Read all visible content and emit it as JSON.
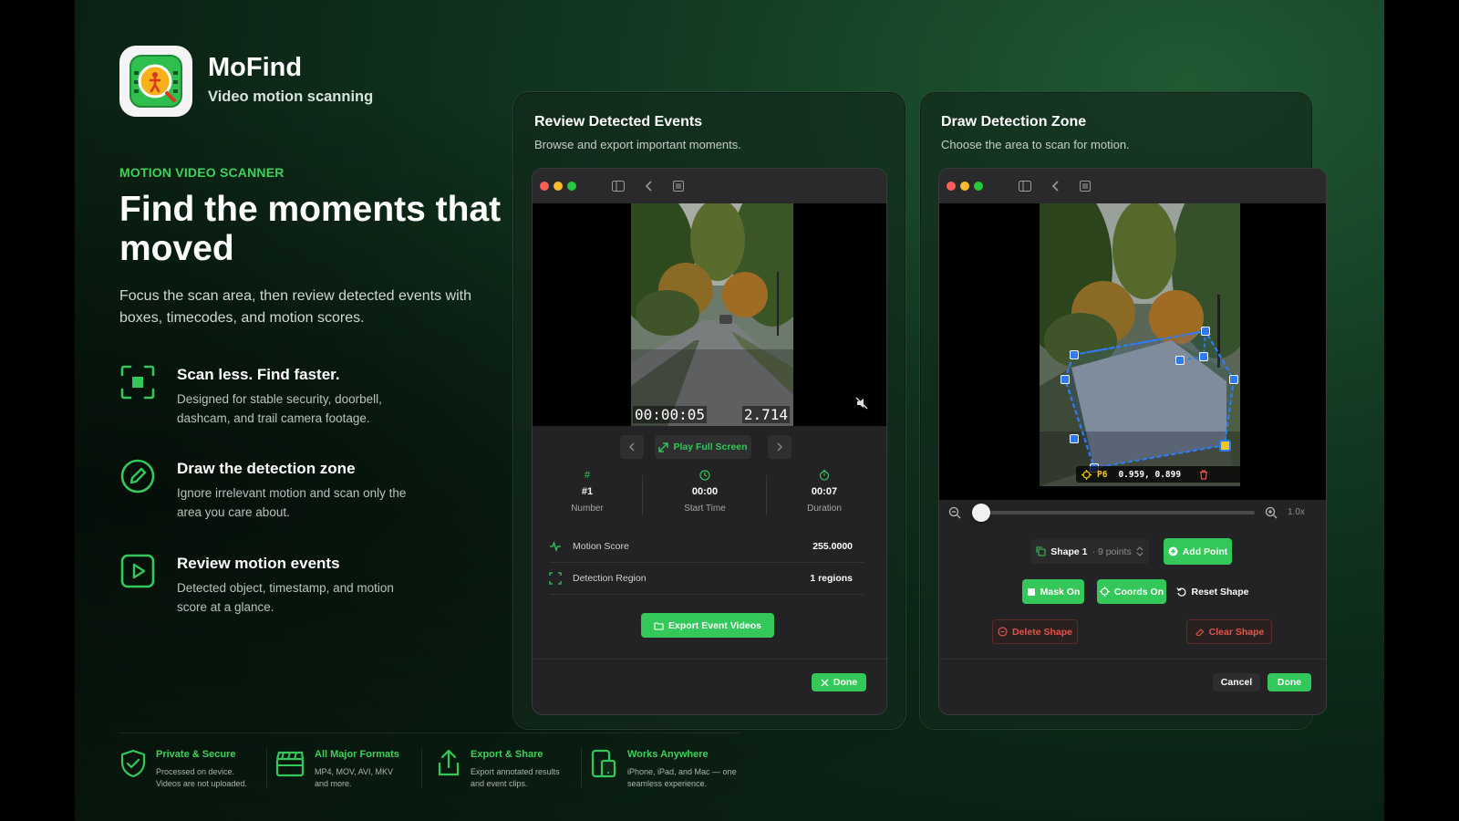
{
  "app": {
    "name": "MoFind",
    "subtitle": "Video motion scanning"
  },
  "hero": {
    "eyebrow": "MOTION VIDEO SCANNER",
    "headline": "Find the moments that moved",
    "lede": "Focus the scan area, then review detected events with boxes, timecodes, and motion scores."
  },
  "features": [
    {
      "title": "Scan less. Find faster.",
      "desc": "Designed for stable security, doorbell, dashcam, and trail camera footage.",
      "icon": "scan-frame-icon"
    },
    {
      "title": "Draw the detection zone",
      "desc": "Ignore irrelevant motion and scan only the area you care about.",
      "icon": "pencil-circle-icon"
    },
    {
      "title": "Review motion events",
      "desc": "Detected object, timestamp, and motion score at a glance.",
      "icon": "play-square-icon"
    }
  ],
  "strip": [
    {
      "title": "Private & Secure",
      "desc": "Processed on device. Videos are not uploaded.",
      "icon": "shield-check-icon"
    },
    {
      "title": "All Major Formats",
      "desc": "MP4, MOV, AVI, MKV and more.",
      "icon": "clapperboard-icon"
    },
    {
      "title": "Export & Share",
      "desc": "Export annotated results and event clips.",
      "icon": "share-icon"
    },
    {
      "title": "Works Anywhere",
      "desc": "iPhone, iPad, and Mac — one seamless experience.",
      "icon": "devices-icon"
    }
  ],
  "review": {
    "title": "Review Detected Events",
    "subtitle": "Browse and export important moments.",
    "timecode": "00:00:05",
    "score_overlay": "2.714",
    "play_full_screen": "Play Full Screen",
    "stats": [
      {
        "icon": "#",
        "value": "#1",
        "label": "Number"
      },
      {
        "icon": "clock-icon",
        "value": "00:00",
        "label": "Start Time"
      },
      {
        "icon": "timer-icon",
        "value": "00:07",
        "label": "Duration"
      }
    ],
    "rows": [
      {
        "label": "Motion Score",
        "value": "255.0000",
        "icon": "waveform-icon"
      },
      {
        "label": "Detection Region",
        "value": "1 regions",
        "icon": "region-icon"
      }
    ],
    "export_label": "Export Event Videos",
    "done_label": "Done"
  },
  "zone": {
    "title": "Draw Detection Zone",
    "subtitle": "Choose the area to scan for motion.",
    "point_label": "P6",
    "point_coords": "0.959, 0.899",
    "zoom_label": "1.0x",
    "zoom_level": 0.0,
    "shape_name": "Shape 1",
    "shape_points": "· 9 points",
    "add_point": "Add Point",
    "mask_on": "Mask On",
    "coords_on": "Coords On",
    "reset_shape": "Reset Shape",
    "delete_shape": "Delete Shape",
    "clear_shape": "Clear Shape",
    "cancel": "Cancel",
    "done": "Done"
  },
  "colors": {
    "accent": "#34c759",
    "brand_text": "#3fd15a",
    "handle": "#2f7bf5",
    "active_handle": "#f5c518",
    "danger": "#e5534b"
  }
}
